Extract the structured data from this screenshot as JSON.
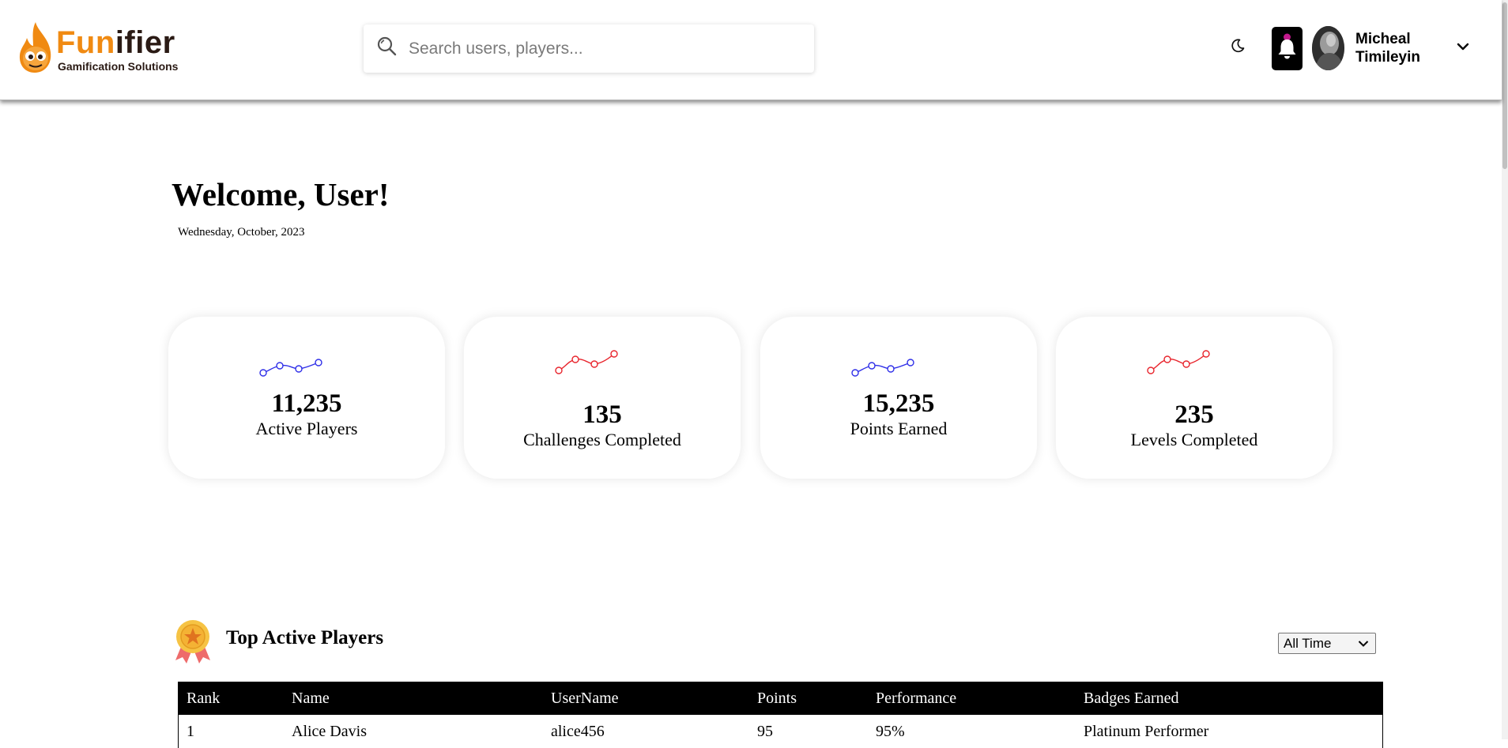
{
  "header": {
    "logo": {
      "word_a": "Fun",
      "word_b": "ifier",
      "tagline": "Gamification Solutions"
    },
    "search": {
      "placeholder": "Search users, players..."
    },
    "user": {
      "first_name": "Micheal",
      "last_name": "Timileyin"
    }
  },
  "welcome": {
    "title": "Welcome, User!",
    "date": "Wednesday, October, 2023"
  },
  "stats": [
    {
      "value": "11,235",
      "label": "Active Players",
      "color": "#2f2fe8"
    },
    {
      "value": "135",
      "label": "Challenges Completed",
      "color": "#e8242c"
    },
    {
      "value": "15,235",
      "label": "Points Earned",
      "color": "#2f2fe8"
    },
    {
      "value": "235",
      "label": "Levels Completed",
      "color": "#e8242c"
    }
  ],
  "top_players": {
    "title": "Top Active Players",
    "range": {
      "selected": "All Time"
    },
    "columns": [
      "Rank",
      "Name",
      "UserName",
      "Points",
      "Performance",
      "Badges Earned"
    ],
    "rows": [
      [
        "1",
        "Alice Davis",
        "alice456",
        "95",
        "95%",
        "Platinum Performer"
      ]
    ]
  },
  "colors": {
    "brand_orange": "#f08a12",
    "brand_dark": "#2a1a14",
    "sparkline_blue": "#2f2fe8",
    "sparkline_red": "#e8242c",
    "medal_gold": "#f6c344",
    "medal_ribbon": "#ee6b6b"
  }
}
